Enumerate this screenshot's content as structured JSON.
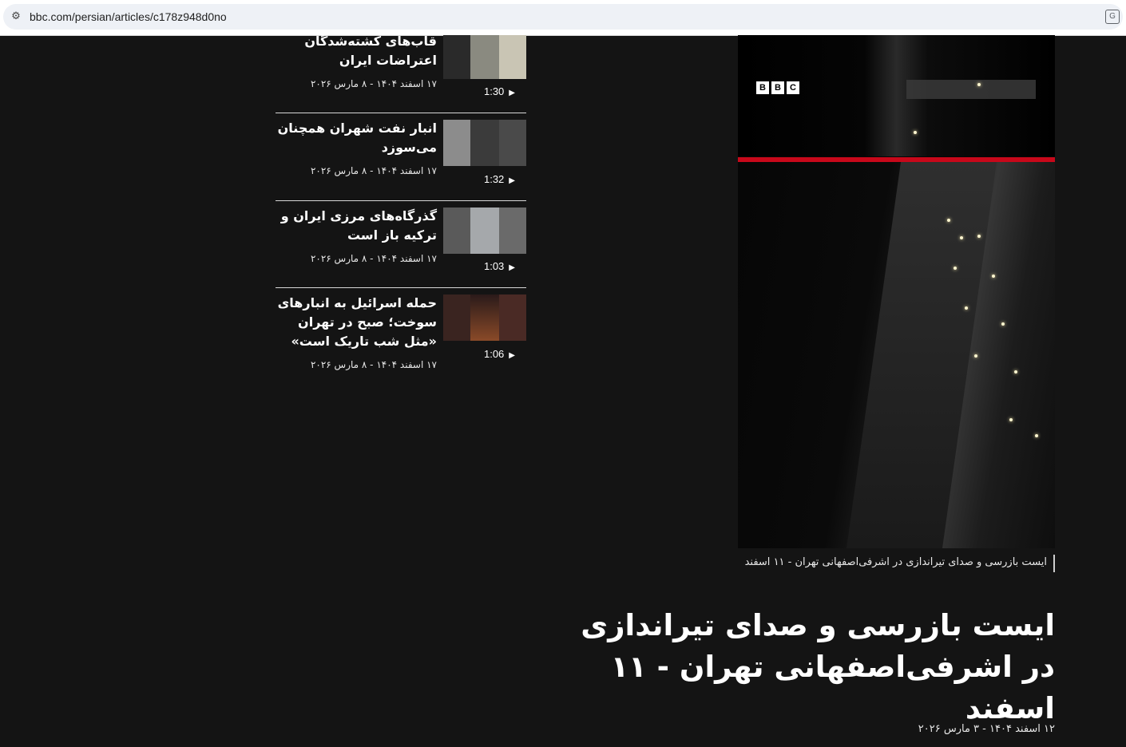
{
  "browser": {
    "url": "bbc.com/persian/articles/c178z948d0no",
    "site_info_icon": "tune-icon",
    "translate_icon": "translate-icon"
  },
  "sidebar": {
    "items": [
      {
        "title": "قاب‌های کشته‌شدگان اعتراضات ایران",
        "date": "۱۷ اسفند ۱۴۰۴ - ۸ مارس ۲۰۲۶",
        "duration": "1:30",
        "thumb_colors": [
          "#2a2a2a",
          "#8a8a80",
          "#c9c5b4"
        ]
      },
      {
        "title": "انبار نفت شهران همچنان می‌سوزد",
        "date": "۱۷ اسفند ۱۴۰۴ - ۸ مارس ۲۰۲۶",
        "duration": "1:32",
        "thumb_colors": [
          "#8c8c8c",
          "#3b3b3b",
          "#4a4a4a"
        ]
      },
      {
        "title": "گذرگاه‌های مرزی ایران و ترکیه باز است",
        "date": "۱۷ اسفند ۱۴۰۴ - ۸ مارس ۲۰۲۶",
        "duration": "1:03",
        "thumb_colors": [
          "#5a5a5a",
          "#a5a8ab",
          "#6a6a6a"
        ]
      },
      {
        "title": "حمله اسرائیل به انبارهای سوخت؛ صبح در تهران «مثل شب تاریک است»",
        "date": "۱۷ اسفند ۱۴۰۴ - ۸ مارس ۲۰۲۶",
        "duration": "1:06",
        "thumb_colors": [
          "#3a2420",
          "#7a3a22",
          "#4a2a25"
        ]
      }
    ]
  },
  "video": {
    "logo": [
      "B",
      "B",
      "C"
    ],
    "accent_color": "#c8081a"
  },
  "caption": "ایست بازرسی و صدای تیراندازی در اشرفی‌اصفهانی تهران - ۱۱ اسفند",
  "headline": "ایست بازرسی و صدای تیراندازی در اشرفی‌اصفهانی تهران - ۱۱ اسفند",
  "published": "۱۲ اسفند ۱۴۰۴ - ۳ مارس ۲۰۲۶"
}
